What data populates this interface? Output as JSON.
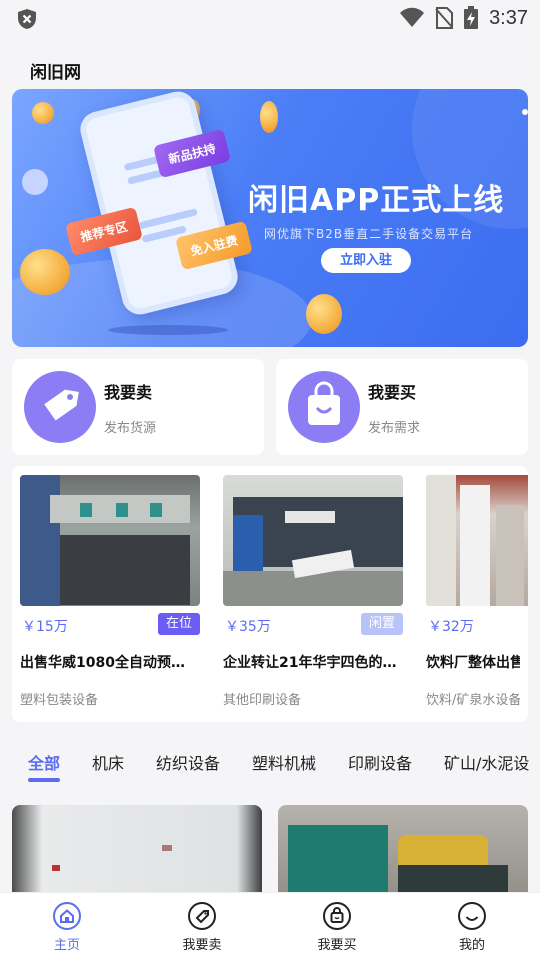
{
  "status_bar": {
    "time": "3:37"
  },
  "app_title": "闲旧网",
  "banner": {
    "title": "闲旧APP正式上线",
    "subtitle": "网优旗下B2B垂直二手设备交易平台",
    "button_label": "立即入驻",
    "tag_new": "新品扶持",
    "tag_recommend": "推荐专区",
    "tag_free": "免入驻费"
  },
  "actions": [
    {
      "title": "我要卖",
      "subtitle": "发布货源"
    },
    {
      "title": "我要买",
      "subtitle": "发布需求"
    }
  ],
  "products": [
    {
      "price": "￥15万",
      "badge": "在位",
      "name": "出售华威1080全自动预…",
      "category": "塑料包装设备"
    },
    {
      "price": "￥35万",
      "badge": "闲置",
      "name": "企业转让21年华宇四色的…",
      "category": "其他印刷设备"
    },
    {
      "price": "￥32万",
      "badge": "",
      "name": "饮料厂整体出售",
      "category": "饮料/矿泉水设备"
    }
  ],
  "categories": [
    "全部",
    "机床",
    "纺织设备",
    "塑料机械",
    "印刷设备",
    "矿山/水泥设"
  ],
  "bottom_nav": [
    "主页",
    "我要卖",
    "我要买",
    "我的"
  ],
  "colors": {
    "accent": "#5b6cf0",
    "badge_active_bg": "#6a5cf5",
    "badge_idle_bg": "#b8c4f7"
  }
}
